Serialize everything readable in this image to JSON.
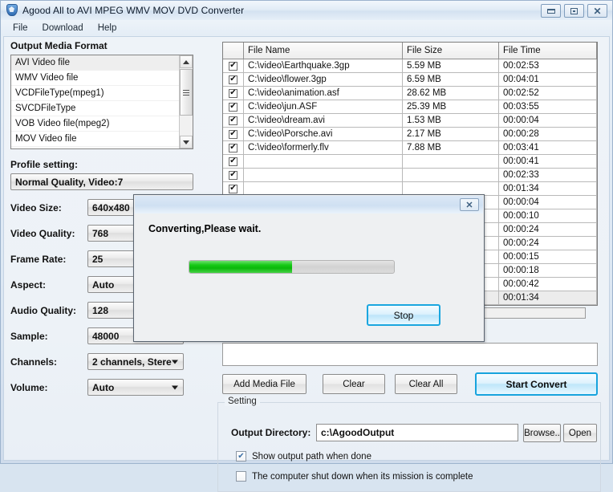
{
  "window": {
    "title": "Agood All to AVI MPEG WMV MOV DVD Converter",
    "icon": "app-shield-icon",
    "controls": {
      "minimize": "–",
      "maximize": "□",
      "close": "✕"
    }
  },
  "menu": {
    "items": [
      "File",
      "Download",
      "Help"
    ]
  },
  "left_panel": {
    "format_group_label": "Output Media Format",
    "formats": [
      "AVI Video file",
      "WMV Video file",
      "VCDFileType(mpeg1)",
      "SVCDFileType",
      "VOB Video file(mpeg2)",
      "MOV Video file"
    ],
    "selected_format": "AVI Video file",
    "profile_label": "Profile setting:",
    "profile_value": "Normal Quality, Video:7",
    "fields": [
      {
        "label": "Video Size:",
        "value": "640x480",
        "has_arrow": false
      },
      {
        "label": "Video Quality:",
        "value": "768",
        "has_arrow": false
      },
      {
        "label": "Frame Rate:",
        "value": "25",
        "has_arrow": false
      },
      {
        "label": "Aspect:",
        "value": "Auto",
        "has_arrow": false
      },
      {
        "label": "Audio Quality:",
        "value": "128",
        "has_arrow": true
      },
      {
        "label": "Sample:",
        "value": "48000",
        "has_arrow": true
      },
      {
        "label": "Channels:",
        "value": "2 channels, Stere",
        "has_arrow": true
      },
      {
        "label": "Volume:",
        "value": "Auto",
        "has_arrow": true
      }
    ]
  },
  "file_table": {
    "columns": [
      "",
      "File Name",
      "File Size",
      "File Time"
    ],
    "check_glyph": "✔",
    "rows": [
      {
        "checked": true,
        "name": "C:\\video\\Earthquake.3gp",
        "size": "5.59 MB",
        "time": "00:02:53",
        "selected": false
      },
      {
        "checked": true,
        "name": "C:\\video\\flower.3gp",
        "size": "6.59 MB",
        "time": "00:04:01",
        "selected": false
      },
      {
        "checked": true,
        "name": "C:\\video\\animation.asf",
        "size": "28.62 MB",
        "time": "00:02:52",
        "selected": false
      },
      {
        "checked": true,
        "name": "C:\\video\\jun.ASF",
        "size": "25.39 MB",
        "time": "00:03:55",
        "selected": false
      },
      {
        "checked": true,
        "name": "C:\\video\\dream.avi",
        "size": "1.53 MB",
        "time": "00:00:04",
        "selected": false
      },
      {
        "checked": true,
        "name": "C:\\video\\Porsche.avi",
        "size": "2.17 MB",
        "time": "00:00:28",
        "selected": false
      },
      {
        "checked": true,
        "name": "C:\\video\\formerly.flv",
        "size": "7.88 MB",
        "time": "00:03:41",
        "selected": false
      },
      {
        "checked": true,
        "name": "",
        "size": "",
        "time": "00:00:41",
        "selected": false
      },
      {
        "checked": true,
        "name": "",
        "size": "",
        "time": "00:02:33",
        "selected": false
      },
      {
        "checked": true,
        "name": "",
        "size": "",
        "time": "00:01:34",
        "selected": false
      },
      {
        "checked": true,
        "name": "",
        "size": "",
        "time": "00:00:04",
        "selected": false
      },
      {
        "checked": true,
        "name": "",
        "size": "",
        "time": "00:00:10",
        "selected": false
      },
      {
        "checked": true,
        "name": "",
        "size": "",
        "time": "00:00:24",
        "selected": false
      },
      {
        "checked": true,
        "name": "",
        "size": "",
        "time": "00:00:24",
        "selected": false
      },
      {
        "checked": true,
        "name": "",
        "size": "",
        "time": "00:00:15",
        "selected": false
      },
      {
        "checked": true,
        "name": "",
        "size": "",
        "time": "00:00:18",
        "selected": false
      },
      {
        "checked": true,
        "name": "",
        "size": "",
        "time": "00:00:42",
        "selected": false
      },
      {
        "checked": true,
        "name": "",
        "size": "",
        "time": "00:01:34",
        "selected": true
      }
    ]
  },
  "actions": {
    "add_media": "Add Media File",
    "clear": "Clear",
    "clear_all": "Clear All",
    "start_convert": "Start Convert"
  },
  "setting": {
    "legend": "Setting",
    "output_dir_label": "Output Directory:",
    "output_dir_value": "c:\\AgoodOutput",
    "browse": "Browse..",
    "open": "Open",
    "checkbox1": {
      "label": "Show output path when done",
      "checked": true,
      "glyph": "✔"
    },
    "checkbox2": {
      "label": "The computer shut down when its mission is complete",
      "checked": false,
      "glyph": ""
    }
  },
  "dialog": {
    "message": "Converting,Please wait.",
    "progress_percent": 50,
    "stop_label": "Stop",
    "close_glyph": "✕"
  },
  "colors": {
    "accent_blue": "#17a3dd",
    "progress_green": "#17c917",
    "titlebar_top": "#f2f7fc",
    "client_bg": "#eef3f8"
  }
}
